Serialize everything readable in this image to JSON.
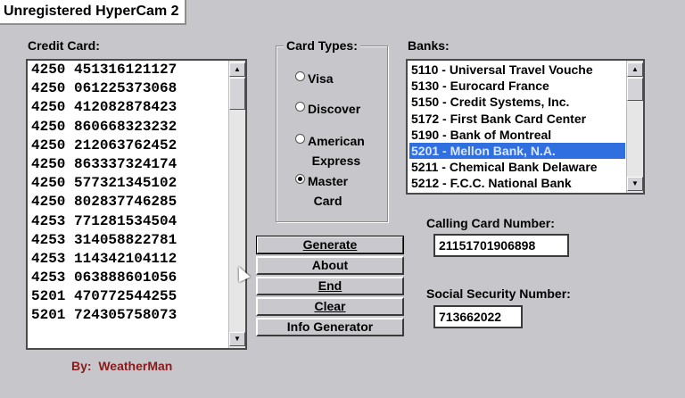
{
  "window": {
    "watermark": "Unregistered HyperCam 2"
  },
  "credit_card": {
    "label": "Credit Card:",
    "numbers": [
      "4250 451316121127",
      "4250 061225373068",
      "4250 412082878423",
      "4250 860668323232",
      "4250 212063762452",
      "4250 863337324174",
      "4250 577321345102",
      "4250 802837746285",
      "4253 771281534504",
      "4253 314058822781",
      "4253 114342104112",
      "4253 063888601056",
      "5201 470772544255",
      "5201 724305758073"
    ]
  },
  "card_types": {
    "label": "Card Types:",
    "options": [
      {
        "line1": "Visa",
        "line2": "",
        "selected": false
      },
      {
        "line1": "Discover",
        "line2": "",
        "selected": false
      },
      {
        "line1": "American",
        "line2": "Express",
        "selected": false
      },
      {
        "line1": "Master",
        "line2": "Card",
        "selected": true
      }
    ]
  },
  "banks": {
    "label": "Banks:",
    "items": [
      "5110 - Universal Travel Vouche",
      "5130 - Eurocard France",
      "5150 - Credit Systems, Inc.",
      "5172 - First Bank Card Center",
      "5190 - Bank of Montreal",
      "5201 - Mellon Bank, N.A.",
      "5211 - Chemical Bank Delaware",
      "5212 - F.C.C. National Bank"
    ],
    "selected_index": 5
  },
  "buttons": {
    "generate": "Generate",
    "about": "About",
    "end": "End",
    "clear": "Clear",
    "info_generator": "Info Generator"
  },
  "calling_card": {
    "label": "Calling Card Number:",
    "value": "21151701906898"
  },
  "ssn": {
    "label": "Social Security Number:",
    "value": "713662022"
  },
  "credit": {
    "by": "By:",
    "author": "WeatherMan"
  },
  "icons": {
    "up": "▲",
    "down": "▼"
  }
}
